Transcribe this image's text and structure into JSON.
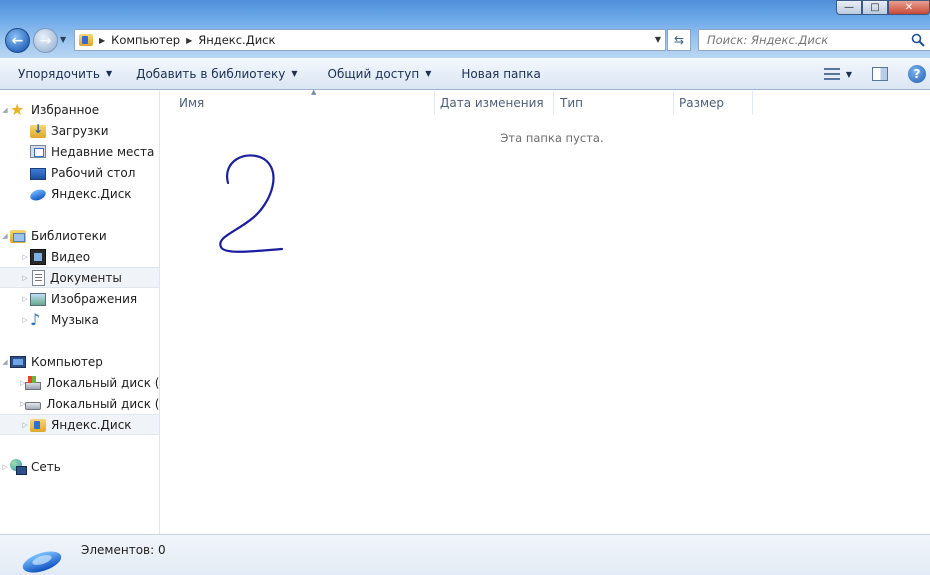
{
  "window": {
    "minimize_glyph": "—",
    "maximize_glyph": "□",
    "close_glyph": "✕"
  },
  "address": {
    "crumbs": [
      "Компьютер",
      "Яндекс.Диск"
    ]
  },
  "search": {
    "placeholder": "Поиск: Яндекс.Диск"
  },
  "toolbar": {
    "organize": "Упорядочить",
    "add_to_library": "Добавить в библиотеку",
    "share": "Общий доступ",
    "new_folder": "Новая папка"
  },
  "navigation": {
    "favorites": {
      "label": "Избранное",
      "items": [
        "Загрузки",
        "Недавние места",
        "Рабочий стол",
        "Яндекс.Диск"
      ]
    },
    "libraries": {
      "label": "Библиотеки",
      "items": [
        "Видео",
        "Документы",
        "Изображения",
        "Музыка"
      ]
    },
    "computer": {
      "label": "Компьютер",
      "items": [
        "Локальный диск (C",
        "Локальный диск (D",
        "Яндекс.Диск"
      ]
    },
    "network": {
      "label": "Сеть"
    }
  },
  "columns": [
    "Имя",
    "Дата изменения",
    "Тип",
    "Размер"
  ],
  "content": {
    "empty_message": "Эта папка пуста."
  },
  "status": {
    "items_count": "Элементов: 0"
  },
  "colors": {
    "scribble": "#1b1f9e",
    "selection_bg": "#f0f3f7"
  }
}
